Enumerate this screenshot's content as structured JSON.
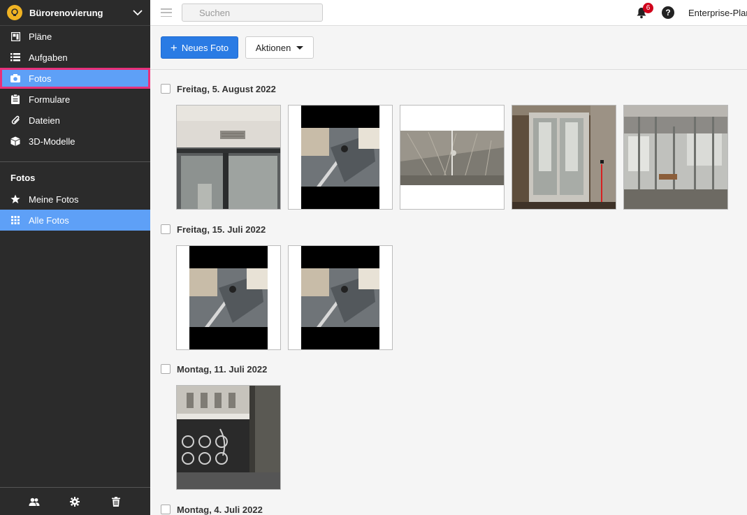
{
  "project": {
    "title": "Bürorenovierung"
  },
  "nav": {
    "items": [
      {
        "label": "Pläne",
        "icon": "plans-icon"
      },
      {
        "label": "Aufgaben",
        "icon": "list-icon"
      },
      {
        "label": "Fotos",
        "icon": "camera-icon"
      },
      {
        "label": "Formulare",
        "icon": "clipboard-icon"
      },
      {
        "label": "Dateien",
        "icon": "paperclip-icon"
      },
      {
        "label": "3D-Modelle",
        "icon": "cube-icon"
      }
    ],
    "section_title": "Fotos",
    "sub_items": [
      {
        "label": "Meine Fotos",
        "icon": "star-icon"
      },
      {
        "label": "Alle Fotos",
        "icon": "grid-icon"
      }
    ]
  },
  "footer_icons": [
    "users-icon",
    "gear-icon",
    "trash-icon"
  ],
  "search": {
    "placeholder": "Suchen"
  },
  "notifications": {
    "count": "6"
  },
  "help": {
    "label": "?"
  },
  "plan": {
    "label": "Enterprise-Plan"
  },
  "toolbar": {
    "new_photo_label": "Neues Foto",
    "actions_label": "Aktionen"
  },
  "groups": [
    {
      "date": "Freitag, 5. August 2022",
      "photo_count": 5
    },
    {
      "date": "Freitag, 15. Juli 2022",
      "photo_count": 2
    },
    {
      "date": "Montag, 11. Juli 2022",
      "photo_count": 1
    },
    {
      "date": "Montag, 4. Juli 2022",
      "photo_count": 0
    }
  ],
  "colors": {
    "sidebar_bg": "#2b2b2b",
    "active": "#5ea0f7",
    "highlight": "#e8317a",
    "primary": "#2a7be4",
    "badge": "#d0021b"
  }
}
